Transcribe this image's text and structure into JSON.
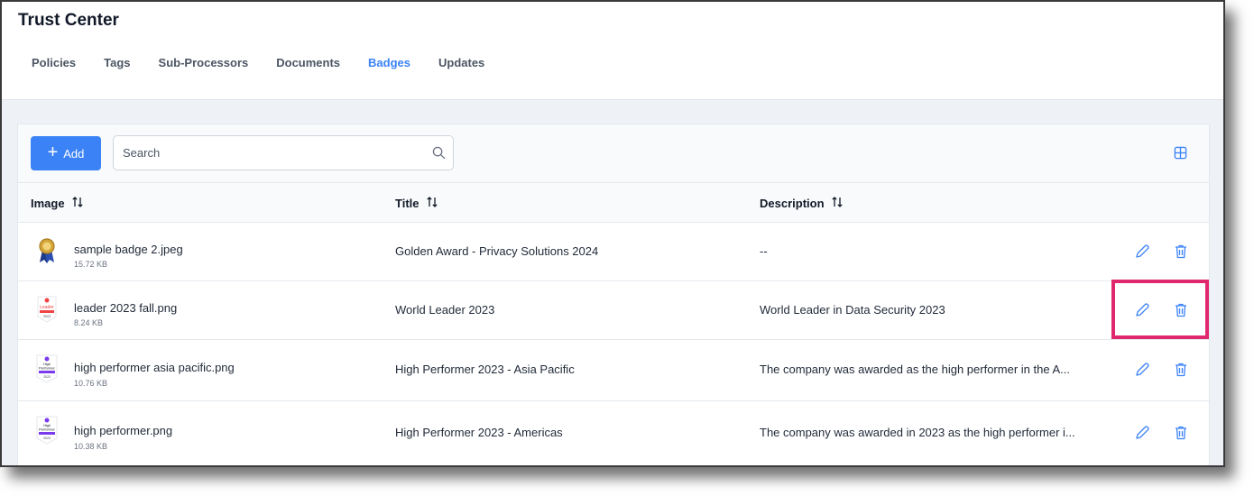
{
  "header": {
    "title": "Trust Center"
  },
  "tabs": [
    {
      "label": "Policies",
      "active": false
    },
    {
      "label": "Tags",
      "active": false
    },
    {
      "label": "Sub-Processors",
      "active": false
    },
    {
      "label": "Documents",
      "active": false
    },
    {
      "label": "Badges",
      "active": true
    },
    {
      "label": "Updates",
      "active": false
    }
  ],
  "toolbar": {
    "add_label": "Add",
    "search_placeholder": "Search",
    "icons": {
      "add": "plus-icon",
      "search": "search-icon",
      "columns": "grid-icon"
    }
  },
  "table": {
    "columns": [
      {
        "label": "Image",
        "icon": "sort-icon"
      },
      {
        "label": "Title",
        "icon": "sort-icon"
      },
      {
        "label": "Description",
        "icon": "sort-icon"
      }
    ],
    "rows": [
      {
        "file_name": "sample badge 2.jpeg",
        "file_size": "15.72 KB",
        "title": "Golden Award - Privacy Solutions 2024",
        "description": "--",
        "thumb": "gold-medal-icon"
      },
      {
        "file_name": "leader 2023 fall.png",
        "file_size": "8.24 KB",
        "title": "World Leader 2023",
        "description": "World Leader in Data Security 2023",
        "thumb": "leader-badge-icon",
        "thumb_text": [
          "Leader",
          "2023"
        ]
      },
      {
        "file_name": "high performer asia pacific.png",
        "file_size": "10.76 KB",
        "title": "High Performer 2023 - Asia Pacific",
        "description": "The company was awarded as the high performer in the A...",
        "thumb": "high-performer-badge-icon",
        "thumb_text": [
          "High",
          "Performer",
          "2023"
        ]
      },
      {
        "file_name": "high performer.png",
        "file_size": "10.38 KB",
        "title": "High Performer 2023 - Americas",
        "description": "The company was awarded in 2023 as the high performer i...",
        "thumb": "high-performer-badge-icon",
        "thumb_text": [
          "High",
          "Performer",
          "2023"
        ]
      }
    ],
    "row_actions": {
      "edit": "pencil-icon",
      "delete": "trash-icon"
    }
  },
  "colors": {
    "accent": "#3b82f6",
    "highlight": "#e0286f",
    "background": "#eef2f6"
  }
}
